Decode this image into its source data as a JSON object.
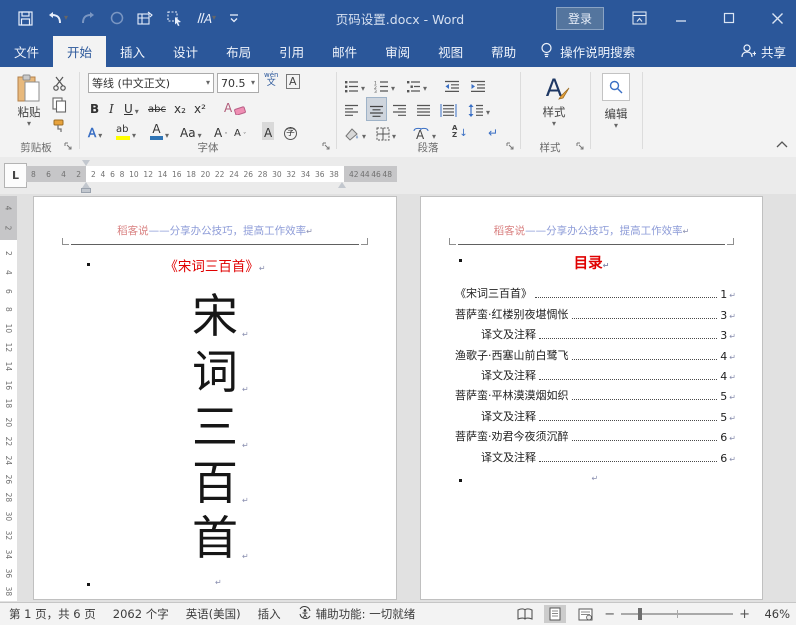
{
  "titlebar": {
    "title": "页码设置.docx - Word",
    "login_label": "登录"
  },
  "tabs": {
    "file": "文件",
    "home": "开始",
    "insert": "插入",
    "design": "设计",
    "layout": "布局",
    "references": "引用",
    "mailings": "邮件",
    "review": "审阅",
    "view": "视图",
    "help": "帮助",
    "tellme": "操作说明搜索",
    "share": "共享"
  },
  "ribbon": {
    "paste_label": "粘贴",
    "clipboard_label": "剪贴板",
    "font_name": "等线 (中文正文)",
    "font_size": "70.5",
    "font_label": "字体",
    "paragraph_label": "段落",
    "styles_button": "样式",
    "styles_label": "样式",
    "editing_button": "编辑"
  },
  "icons": {
    "chevron_down": "▾",
    "bold": "B",
    "italic": "I",
    "underline": "U",
    "strikethrough": "abc",
    "subscript": "x₂",
    "superscript": "x²",
    "clear_formatting": "A",
    "text_effects": "A",
    "highlight": "ab",
    "font_color": "A",
    "change_case": "Aa",
    "grow_font": "A",
    "shrink_font": "A",
    "char_shading": "A",
    "enclose_char": "字",
    "phonetic_pinyin": "wén",
    "phonetic_char": "文",
    "char_border": "A",
    "sort_a": "A",
    "sort_z": "Z",
    "arrow_down": "↓",
    "para_mark": "↵",
    "tab_stop": "L",
    "minus": "−",
    "plus": "+"
  },
  "ruler": {
    "h_left": [
      "8",
      "6",
      "4",
      "2"
    ],
    "h_mid": [
      "2",
      "4",
      "6",
      "8",
      "10",
      "12",
      "14",
      "16",
      "18",
      "20",
      "22",
      "24",
      "26",
      "28",
      "30",
      "32",
      "34",
      "36",
      "38"
    ],
    "h_right": [
      "42",
      "44",
      "46",
      "48"
    ],
    "v_top": [
      "4",
      "2"
    ],
    "v_mid": [
      "2",
      "4",
      "6",
      "8",
      "10",
      "12",
      "14",
      "16",
      "18",
      "20",
      "22",
      "24",
      "26",
      "28",
      "30",
      "32",
      "34",
      "36",
      "38"
    ]
  },
  "page1": {
    "header_brand": "稻客说",
    "header_rest": "——分享办公技巧，提高工作效率",
    "title": "《宋词三百首》",
    "chars": [
      "宋",
      "词",
      "三",
      "百",
      "首"
    ]
  },
  "page2": {
    "header_brand": "稻客说",
    "header_rest": "——分享办公技巧，提高工作效率",
    "title": "目录",
    "toc": [
      {
        "text": "《宋词三百首》",
        "page": "1",
        "sub": false
      },
      {
        "text": "菩萨蛮·红楼别夜堪惆怅",
        "page": "3",
        "sub": false
      },
      {
        "text": "译文及注释",
        "page": "3",
        "sub": true
      },
      {
        "text": "渔歌子·西塞山前白鹭飞",
        "page": "4",
        "sub": false
      },
      {
        "text": "译文及注释",
        "page": "4",
        "sub": true
      },
      {
        "text": "菩萨蛮·平林漠漠烟如织",
        "page": "5",
        "sub": false
      },
      {
        "text": "译文及注释",
        "page": "5",
        "sub": true
      },
      {
        "text": "菩萨蛮·劝君今夜须沉醉",
        "page": "6",
        "sub": false
      },
      {
        "text": "译文及注释",
        "page": "6",
        "sub": true
      }
    ]
  },
  "statusbar": {
    "page_info": "第 1 页，共 6 页",
    "word_count": "2062 个字",
    "language": "英语(美国)",
    "insert_mode": "插入",
    "accessibility": "辅助功能: 一切就绪",
    "zoom": "46%"
  }
}
